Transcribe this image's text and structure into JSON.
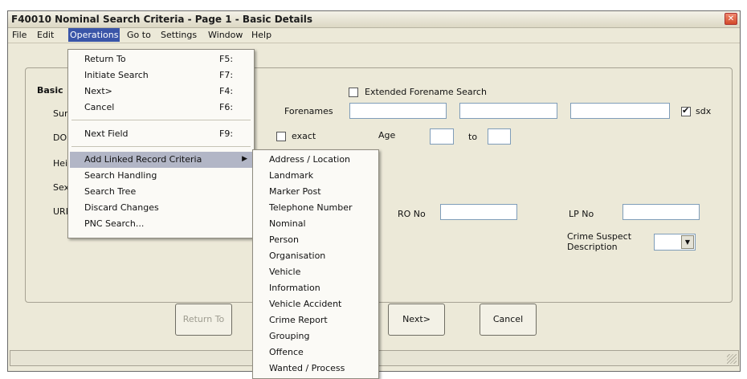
{
  "window": {
    "title": "F40010 Nominal Search Criteria - Page 1 - Basic Details",
    "close": "✕"
  },
  "menubar": [
    "File",
    "Edit",
    "Operations",
    "Go to",
    "Settings",
    "Window",
    "Help"
  ],
  "panel": {
    "section_label": "Basic",
    "side_labels": [
      "Sur",
      "DO",
      "Hei",
      "Sex",
      "URI"
    ],
    "extended_forename": "Extended Forename Search",
    "forenames_label": "Forenames",
    "sdx_label": "sdx",
    "exact_label": "exact",
    "age_label": "Age",
    "to_label": "to",
    "cro_label": "RO No",
    "lp_label": "LP No",
    "crime_suspect_label": "Crime Suspect Description",
    "combo_arrow": "▼"
  },
  "buttons": {
    "return_to": "Return To",
    "next": "Next>",
    "cancel": "Cancel"
  },
  "operations_menu": [
    {
      "label": "Return To",
      "shortcut": "F5:"
    },
    {
      "label": "Initiate Search",
      "shortcut": "F7:"
    },
    {
      "label": "Next>",
      "shortcut": "F4:"
    },
    {
      "label": "Cancel",
      "shortcut": "F6:"
    },
    {
      "label": "Next Field",
      "shortcut": "F9:"
    },
    {
      "label": "Add Linked Record Criteria",
      "shortcut": ""
    },
    {
      "label": "Search Handling",
      "shortcut": ""
    },
    {
      "label": "Search Tree",
      "shortcut": ""
    },
    {
      "label": "Discard Changes",
      "shortcut": ""
    },
    {
      "label": "PNC Search...",
      "shortcut": ""
    }
  ],
  "submenu_arrow": "▶",
  "linked_record_submenu": [
    "Address / Location",
    "Landmark",
    "Marker Post",
    "Telephone Number",
    "Nominal",
    "Person",
    "Organisation",
    "Vehicle",
    "Information",
    "Vehicle Accident",
    "Crime Report",
    "Grouping",
    "Offence",
    "Wanted / Process"
  ]
}
